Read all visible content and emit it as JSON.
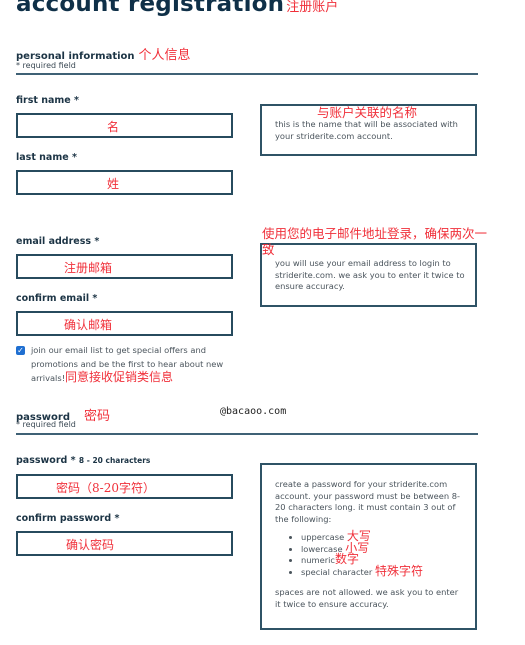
{
  "page": {
    "title": "account registration",
    "title_annotation": "注册账户"
  },
  "personal": {
    "heading": "personal information",
    "heading_annotation": "个人信息",
    "required_note": "* required field",
    "first_name": {
      "label": "first name *",
      "value": "名"
    },
    "last_name": {
      "label": "last name *",
      "value": "姓"
    },
    "name_info": {
      "annotation": "与账户关联的名称",
      "text": "this is the name that will be associated with your striderite.com account."
    },
    "email": {
      "label": "email address *",
      "value": "注册邮箱"
    },
    "confirm_email": {
      "label": "confirm email *",
      "value": "确认邮箱"
    },
    "email_info": {
      "annotation": "使用您的电子邮件地址登录，确保两次一致",
      "text": "you will use your email address to login to striderite.com. we ask you to enter it twice to ensure accuracy."
    },
    "optin": {
      "checked": true,
      "text": "join our email list to get special offers and promotions and be the first to hear about new arrivals!",
      "annotation": "同意接收促销类信息"
    }
  },
  "password_section": {
    "heading": "password",
    "heading_annotation": "密码",
    "required_note": "* required field",
    "watermark": "@bacaoo.com",
    "password": {
      "label": "password *",
      "hint": "8 - 20 characters",
      "value": "密码（8-20字符）"
    },
    "confirm_password": {
      "label": "confirm password *",
      "value": "确认密码"
    },
    "info": {
      "intro": "create a password for your striderite.com account. your password must be between 8-20 characters long. it must contain 3 out of the following:",
      "rules": [
        {
          "text": "uppercase",
          "annotation": "大写"
        },
        {
          "text": "lowercase",
          "annotation": "小写"
        },
        {
          "text": "numeric",
          "annotation": "数字"
        },
        {
          "text": "special character",
          "annotation": "特殊字符"
        }
      ],
      "outro": "spaces are not allowed. we ask you to enter it twice to ensure accuracy."
    }
  }
}
